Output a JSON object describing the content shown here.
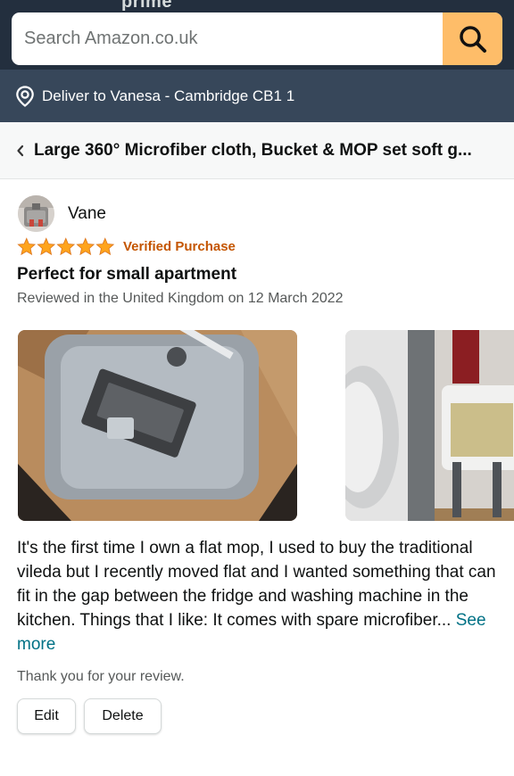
{
  "header": {
    "prime_text": "prime",
    "search_placeholder": "Search Amazon.co.uk",
    "search_icon": "search-icon"
  },
  "delivery": {
    "icon": "location-pin-icon",
    "text": "Deliver to Vanesa - Cambridge CB1 1"
  },
  "product": {
    "back_icon": "chevron-left-icon",
    "title": "Large 360° Microfiber cloth, Bucket & MOP set soft g..."
  },
  "review": {
    "reviewer_name": "Vane",
    "rating": 5,
    "rating_max": 5,
    "verified_label": "Verified Purchase",
    "title": "Perfect for small apartment",
    "meta": "Reviewed in the United Kingdom on 12 March 2022",
    "body": "It's the first time I own a flat mop, I used to buy the traditional vileda but I recently moved flat and I wanted something that can fit in the gap between the fridge and washing machine in the kitchen. Things that I like: It comes with spare microfiber...",
    "see_more": "See more",
    "thanks": "Thank you for your review.",
    "edit_label": "Edit",
    "delete_label": "Delete"
  },
  "colors": {
    "header_bg": "#232f3e",
    "deliver_bg": "#37475a",
    "search_button": "#febd69",
    "star": "#ffa41c",
    "verified": "#c45500",
    "link": "#007185"
  }
}
